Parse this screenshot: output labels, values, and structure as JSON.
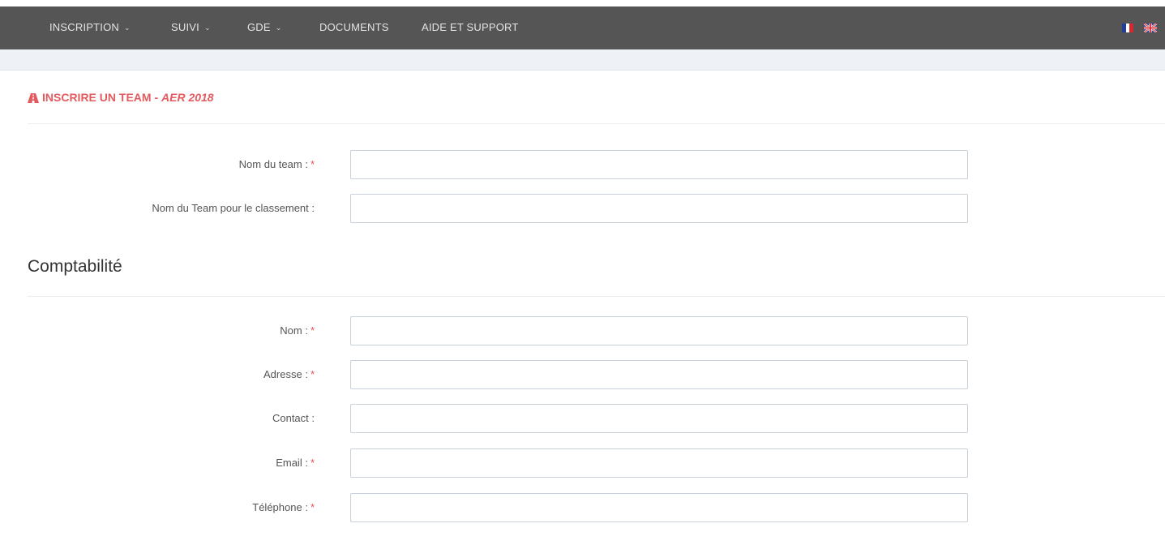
{
  "nav": {
    "items": [
      {
        "label": "INSCRIPTION",
        "has_dropdown": true
      },
      {
        "label": "SUIVI",
        "has_dropdown": true
      },
      {
        "label": "GDE",
        "has_dropdown": true
      },
      {
        "label": "DOCUMENTS",
        "has_dropdown": false
      },
      {
        "label": "AIDE ET SUPPORT",
        "has_dropdown": false
      }
    ],
    "chevron_glyph": "⌄",
    "languages": [
      "fr-flag-icon",
      "uk-flag-icon"
    ]
  },
  "page": {
    "title_icon": "road-icon",
    "title": "INSCRIRE UN TEAM - ",
    "title_sub": "AER 2018"
  },
  "team_fields": [
    {
      "label": "Nom du team :",
      "required": true,
      "value": ""
    },
    {
      "label": "Nom du Team pour le classement :",
      "required": false,
      "value": ""
    }
  ],
  "accounting": {
    "title": "Comptabilité",
    "fields": [
      {
        "label": "Nom :",
        "required": true,
        "value": ""
      },
      {
        "label": "Adresse :",
        "required": true,
        "value": ""
      },
      {
        "label": "Contact :",
        "required": false,
        "value": ""
      },
      {
        "label": "Email :",
        "required": true,
        "value": ""
      },
      {
        "label": "Téléphone :",
        "required": true,
        "value": ""
      }
    ]
  },
  "required_marker": "*",
  "colors": {
    "navbar": "#555555",
    "accent": "#e35a5f",
    "required": "#e7505a"
  }
}
